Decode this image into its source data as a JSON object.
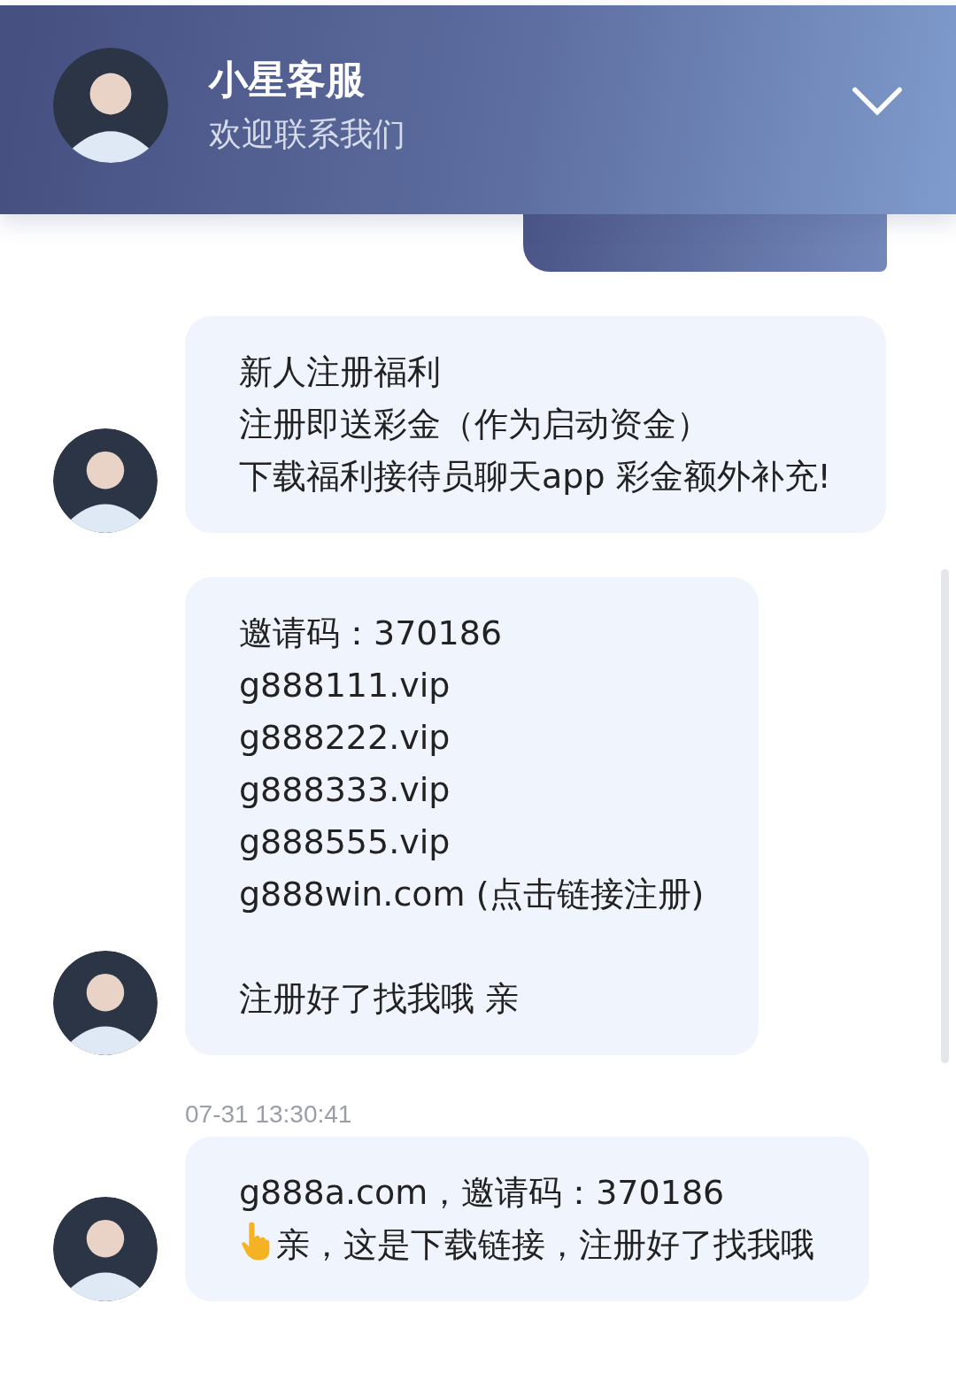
{
  "header": {
    "title": "小星客服",
    "subtitle": "欢迎联系我们"
  },
  "messages": [
    {
      "kind": "sent"
    },
    {
      "kind": "received",
      "blocks": [
        [
          {
            "kind": "plain",
            "text": "新人注册福利"
          },
          {
            "kind": "plain",
            "text": "注册即送彩金（作为启动资金）"
          },
          {
            "kind": "plain",
            "text": "下载福利接待员聊天app 彩金额外补充!"
          }
        ]
      ]
    },
    {
      "kind": "received",
      "blocks": [
        [
          {
            "kind": "plain",
            "text": "邀请码：370186"
          },
          {
            "kind": "plain",
            "text": "g888111.vip"
          },
          {
            "kind": "plain",
            "text": "g888222.vip"
          },
          {
            "kind": "plain",
            "text": "g888333.vip"
          },
          {
            "kind": "plain",
            "text": "g888555.vip"
          },
          {
            "kind": "plain",
            "text": "g888win.com (点击链接注册)"
          }
        ],
        [
          {
            "kind": "plain",
            "text": "注册好了找我哦 亲"
          }
        ]
      ]
    },
    {
      "kind": "received",
      "time": "07-31 13:30:41",
      "blocks": [
        [
          {
            "kind": "plain",
            "text": "g888a.com，邀请码：370186"
          },
          {
            "kind": "pointing",
            "text": "亲，这是下载链接，注册好了找我哦"
          }
        ]
      ]
    }
  ]
}
